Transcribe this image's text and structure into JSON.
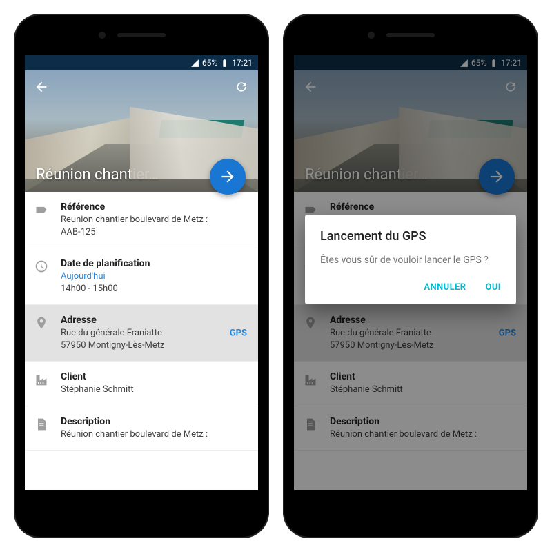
{
  "status": {
    "battery": "65%",
    "time": "17:21"
  },
  "hero": {
    "title": "Réunion chantier…"
  },
  "fields": {
    "reference": {
      "label": "Référence",
      "line1": "Reunion chantier boulevard de Metz :",
      "line2": "AAB-125"
    },
    "date": {
      "label": "Date de planification",
      "day": "Aujourd'hui",
      "time": "14h00 - 15h00"
    },
    "address": {
      "label": "Adresse",
      "line1": "Rue du générale Franiatte",
      "line2": "57950 Montigny-Lès-Metz",
      "gps": "GPS"
    },
    "client": {
      "label": "Client",
      "name": "Stéphanie Schmitt"
    },
    "description": {
      "label": "Description",
      "line1": "Réunion chantier boulevard de Metz :"
    }
  },
  "dialog": {
    "title": "Lancement du GPS",
    "message": "Êtes vous sûr de vouloir lancer le GPS ?",
    "cancel": "ANNULER",
    "ok": "OUI"
  }
}
